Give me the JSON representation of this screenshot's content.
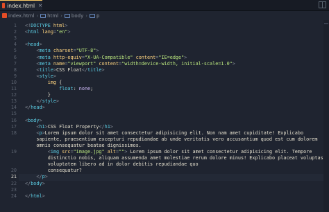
{
  "tab": {
    "title": "index.html",
    "close": "×"
  },
  "breadcrumb": [
    {
      "label": "index.html",
      "icon": "html-file-icon"
    },
    {
      "label": "html",
      "icon": "tag-icon"
    },
    {
      "label": "body",
      "icon": "tag-icon"
    },
    {
      "label": "p",
      "icon": "tag-icon"
    }
  ],
  "separator": "›",
  "active_line": "21",
  "lines": [
    {
      "num": "1",
      "tokens": [
        [
          "t-punct",
          "<!"
        ],
        [
          "t-tag",
          "DOCTYPE"
        ],
        [
          "t-attr",
          " html"
        ],
        [
          "t-punct",
          ">"
        ]
      ]
    },
    {
      "num": "2",
      "tokens": [
        [
          "t-punct",
          "<"
        ],
        [
          "t-tag",
          "html"
        ],
        [
          "t-attr",
          " lang"
        ],
        [
          "t-punct",
          "="
        ],
        [
          "t-str",
          "\"en\""
        ],
        [
          "t-punct",
          ">"
        ]
      ]
    },
    {
      "num": "3",
      "tokens": []
    },
    {
      "num": "4",
      "tokens": [
        [
          "t-punct",
          "<"
        ],
        [
          "t-tag",
          "head"
        ],
        [
          "t-punct",
          ">"
        ]
      ]
    },
    {
      "num": "5",
      "tokens": [
        [
          "t-text",
          "    "
        ],
        [
          "t-punct",
          "<"
        ],
        [
          "t-tag",
          "meta"
        ],
        [
          "t-attr",
          " charset"
        ],
        [
          "t-punct",
          "="
        ],
        [
          "t-str",
          "\"UTF-8\""
        ],
        [
          "t-punct",
          ">"
        ]
      ]
    },
    {
      "num": "6",
      "tokens": [
        [
          "t-text",
          "    "
        ],
        [
          "t-punct",
          "<"
        ],
        [
          "t-tag",
          "meta"
        ],
        [
          "t-attr",
          " http-equiv"
        ],
        [
          "t-punct",
          "="
        ],
        [
          "t-str",
          "\"X-UA-Compatible\""
        ],
        [
          "t-attr",
          " content"
        ],
        [
          "t-punct",
          "="
        ],
        [
          "t-str",
          "\"IE=edge\""
        ],
        [
          "t-punct",
          ">"
        ]
      ]
    },
    {
      "num": "7",
      "tokens": [
        [
          "t-text",
          "    "
        ],
        [
          "t-punct",
          "<"
        ],
        [
          "t-tag",
          "meta"
        ],
        [
          "t-attr",
          " name"
        ],
        [
          "t-punct",
          "="
        ],
        [
          "t-str",
          "\"viewport\""
        ],
        [
          "t-attr",
          " content"
        ],
        [
          "t-punct",
          "="
        ],
        [
          "t-str",
          "\"width=device-width, initial-scale=1.0\""
        ],
        [
          "t-punct",
          ">"
        ]
      ]
    },
    {
      "num": "8",
      "tokens": [
        [
          "t-text",
          "    "
        ],
        [
          "t-punct",
          "<"
        ],
        [
          "t-tag",
          "title"
        ],
        [
          "t-punct",
          ">"
        ],
        [
          "t-text",
          "CSS Float"
        ],
        [
          "t-punct",
          "</"
        ],
        [
          "t-tag",
          "title"
        ],
        [
          "t-punct",
          ">"
        ]
      ]
    },
    {
      "num": "9",
      "tokens": [
        [
          "t-text",
          "    "
        ],
        [
          "t-punct",
          "<"
        ],
        [
          "t-tag",
          "style"
        ],
        [
          "t-punct",
          ">"
        ]
      ]
    },
    {
      "num": "10",
      "tokens": [
        [
          "t-text",
          "        "
        ],
        [
          "t-sel",
          "img"
        ],
        [
          "t-text",
          " {"
        ]
      ]
    },
    {
      "num": "11",
      "tokens": [
        [
          "t-text",
          "            "
        ],
        [
          "t-prop",
          "float"
        ],
        [
          "t-text",
          ": "
        ],
        [
          "t-val",
          "none"
        ],
        [
          "t-text",
          ";"
        ]
      ]
    },
    {
      "num": "12",
      "tokens": [
        [
          "t-text",
          "        }"
        ]
      ]
    },
    {
      "num": "13",
      "tokens": [
        [
          "t-text",
          "    "
        ],
        [
          "t-punct",
          "</"
        ],
        [
          "t-tag",
          "style"
        ],
        [
          "t-punct",
          ">"
        ]
      ]
    },
    {
      "num": "14",
      "tokens": [
        [
          "t-punct",
          "</"
        ],
        [
          "t-tag",
          "head"
        ],
        [
          "t-punct",
          ">"
        ]
      ]
    },
    {
      "num": "15",
      "tokens": []
    },
    {
      "num": "16",
      "tokens": [
        [
          "t-punct",
          "<"
        ],
        [
          "t-tag",
          "body"
        ],
        [
          "t-punct",
          ">"
        ]
      ]
    },
    {
      "num": "17",
      "tokens": [
        [
          "t-text",
          "    "
        ],
        [
          "t-punct",
          "<"
        ],
        [
          "t-tag",
          "h1"
        ],
        [
          "t-punct",
          ">"
        ],
        [
          "t-text",
          "CSS Float Property"
        ],
        [
          "t-punct",
          "</"
        ],
        [
          "t-tag",
          "h1"
        ],
        [
          "t-punct",
          ">"
        ]
      ]
    },
    {
      "num": "18",
      "tokens": [
        [
          "t-text",
          "    "
        ],
        [
          "t-punct",
          "<"
        ],
        [
          "t-tag",
          "p"
        ],
        [
          "t-punct",
          ">"
        ],
        [
          "t-text",
          "Lorem ipsum dolor sit amet consectetur adipisicing elit. Non nam amet cupiditate! Explicabo"
        ]
      ]
    },
    {
      "num": "",
      "tokens": [
        [
          "t-text",
          "    sapiente, praesentium excepturi repudiandae ab unde veritatis vero accusantium quod est cum dolorem"
        ]
      ]
    },
    {
      "num": "",
      "tokens": [
        [
          "t-text",
          "    omnis consequatur beatae dignissimos."
        ]
      ]
    },
    {
      "num": "19",
      "tokens": [
        [
          "t-text",
          "        "
        ],
        [
          "t-punct",
          "<"
        ],
        [
          "t-tag",
          "img"
        ],
        [
          "t-attr",
          " src"
        ],
        [
          "t-punct",
          "="
        ],
        [
          "t-str",
          "\"image.jpg\""
        ],
        [
          "t-attr",
          " alt"
        ],
        [
          "t-punct",
          "="
        ],
        [
          "t-str",
          "\"\""
        ],
        [
          "t-punct",
          ">"
        ],
        [
          "t-text",
          " Lorem ipsum dolor sit amet consectetur adipisicing elit. Tempore"
        ]
      ]
    },
    {
      "num": "",
      "tokens": [
        [
          "t-text",
          "        distinctio nobis, aliquam assumenda amet molestiae rerum dolore minus! Explicabo placeat voluptas"
        ]
      ]
    },
    {
      "num": "",
      "tokens": [
        [
          "t-text",
          "        voluptatem libero ad in dolor debitis repudiandae quo"
        ]
      ]
    },
    {
      "num": "20",
      "tokens": [
        [
          "t-text",
          "        consequatur?"
        ]
      ]
    },
    {
      "num": "21",
      "tokens": [
        [
          "t-text",
          "    "
        ],
        [
          "t-punct",
          "</"
        ],
        [
          "t-tag",
          "p"
        ],
        [
          "t-punct",
          ">"
        ]
      ]
    },
    {
      "num": "22",
      "tokens": [
        [
          "t-punct",
          "</"
        ],
        [
          "t-tag",
          "body"
        ],
        [
          "t-punct",
          ">"
        ]
      ]
    },
    {
      "num": "23",
      "tokens": []
    },
    {
      "num": "24",
      "tokens": [
        [
          "t-punct",
          "</"
        ],
        [
          "t-tag",
          "html"
        ],
        [
          "t-punct",
          ">"
        ]
      ]
    }
  ]
}
